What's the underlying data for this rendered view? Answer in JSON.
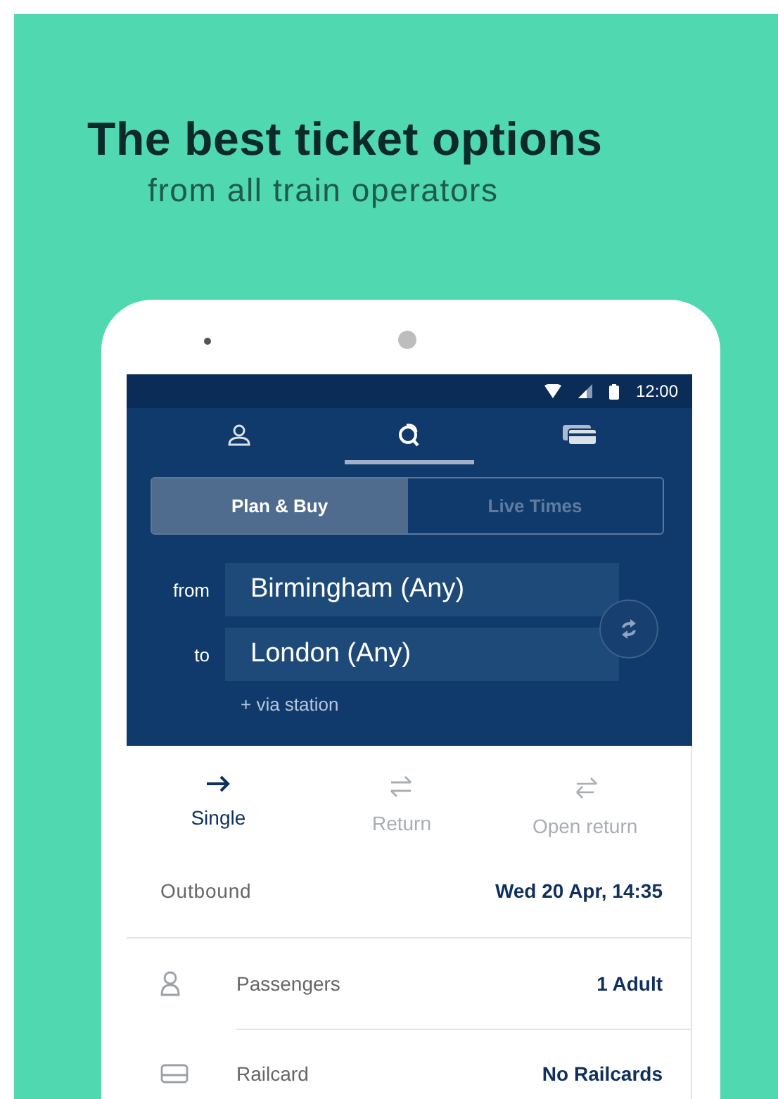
{
  "headline": "The best ticket options",
  "subheadline": "from all train operators",
  "status_bar": {
    "time": "12:00"
  },
  "nav_tabs": [
    {
      "kind": "profile",
      "selected": false
    },
    {
      "kind": "search",
      "selected": true
    },
    {
      "kind": "tickets",
      "selected": false
    }
  ],
  "mode_tabs": [
    {
      "label": "Plan & Buy",
      "selected": true
    },
    {
      "label": "Live Times",
      "selected": false
    }
  ],
  "journey": {
    "from_label": "from",
    "from": "Birmingham (Any)",
    "to_label": "to",
    "to": "London (Any)",
    "via": "+ via station"
  },
  "ticket_types": [
    {
      "kind": "single",
      "label": "Single",
      "selected": true
    },
    {
      "kind": "return",
      "label": "Return",
      "selected": false
    },
    {
      "kind": "open_return",
      "label": "Open return",
      "selected": false
    }
  ],
  "outbound": {
    "label": "Outbound",
    "value": "Wed 20 Apr, 14:35"
  },
  "options": [
    {
      "kind": "passengers",
      "label": "Passengers",
      "value": "1 Adult"
    },
    {
      "kind": "railcard",
      "label": "Railcard",
      "value": "No Railcards"
    }
  ]
}
